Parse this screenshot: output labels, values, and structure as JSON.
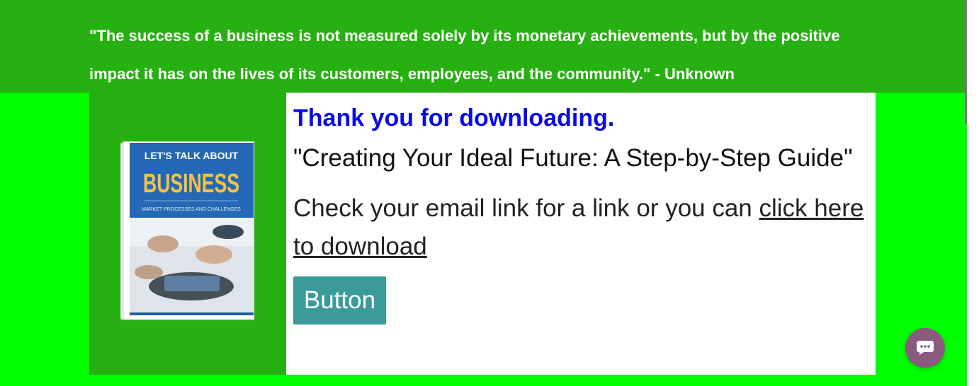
{
  "quote": {
    "text": "\"The success of a business is not measured solely by its monetary achievements, but by the positive impact it has on the lives of its customers, employees, and the community.\" - Unknown"
  },
  "book": {
    "top_text": "LET'S TALK ABOUT",
    "title": "BUSINESS",
    "subtitle": "MARKET PROCESSES AND CHALLENGES"
  },
  "main": {
    "thanks_heading": "Thank you for downloading.",
    "guide_title": "\"Creating Your Ideal Future: A Step-by-Step Guide\"",
    "check_prefix": "Check your email link for a link or you can ",
    "download_link": "click here to download",
    "button_label": "Button"
  },
  "chat": {
    "icon": "chat-bubble-icon"
  },
  "colors": {
    "page_background": "#00ff00",
    "band_green": "#27b011",
    "heading_blue": "#0a0ae8",
    "button_teal": "#3a9b9a",
    "chat_purple": "#8a5a7f"
  }
}
